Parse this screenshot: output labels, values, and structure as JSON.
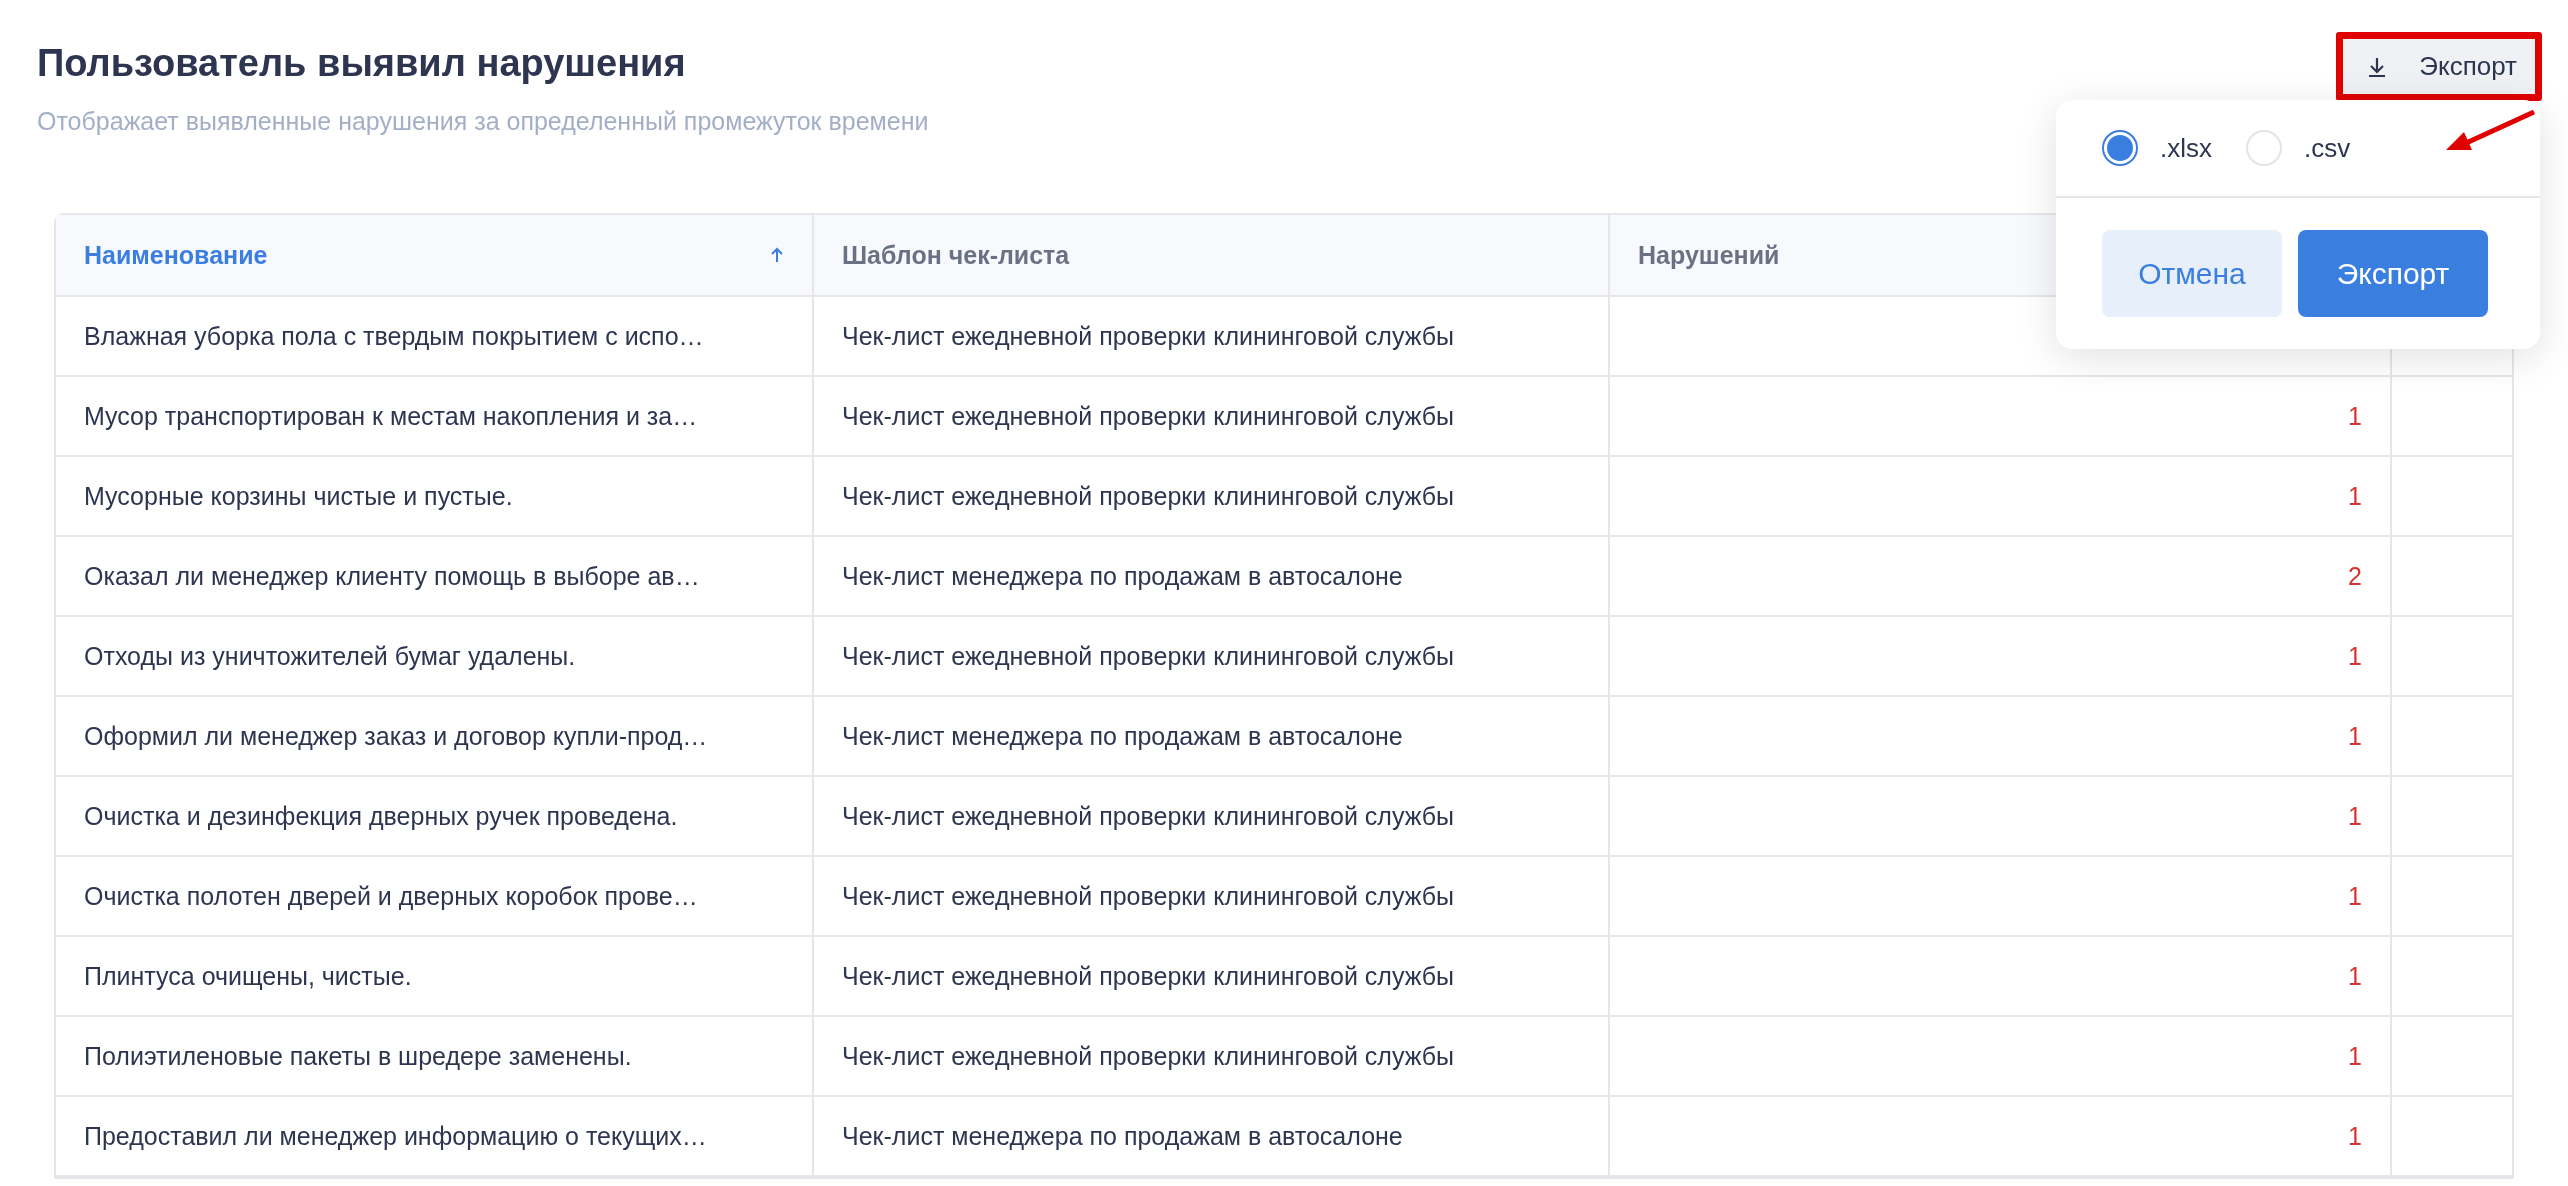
{
  "header": {
    "title": "Пользователь выявил нарушения",
    "subtitle": "Отображает выявленные нарушения за определенный промежуток времени",
    "export_button": "Экспорт"
  },
  "export_popup": {
    "formats": [
      {
        "label": ".xlsx",
        "selected": true
      },
      {
        "label": ".csv",
        "selected": false
      }
    ],
    "cancel": "Отмена",
    "confirm": "Экспорт"
  },
  "table": {
    "columns": [
      {
        "label": "Наименование",
        "sorted": true
      },
      {
        "label": "Шаблон чек-листа",
        "sorted": false
      },
      {
        "label": "Нарушений",
        "sorted": false
      }
    ],
    "rows": [
      {
        "name": "Влажная уборка пола с твердым покрытием с испо…",
        "template": "Чек-лист ежедневной проверки клининговой службы"
      },
      {
        "name": "Мусор транспортирован к местам накопления и за…",
        "template": "Чек-лист ежедневной проверки клининговой службы",
        "violations": "1"
      },
      {
        "name": "Мусорные корзины чистые и пустые.",
        "template": "Чек-лист ежедневной проверки клининговой службы",
        "violations": "1"
      },
      {
        "name": "Оказал ли менеджер клиенту помощь в выборе ав…",
        "template": "Чек-лист менеджера по продажам в автосалоне",
        "violations": "2"
      },
      {
        "name": "Отходы из уничтожителей бумаг удалены.",
        "template": "Чек-лист ежедневной проверки клининговой службы",
        "violations": "1"
      },
      {
        "name": "Оформил ли менеджер заказ и договор купли-прод…",
        "template": "Чек-лист менеджера по продажам в автосалоне",
        "violations": "1"
      },
      {
        "name": "Очистка и дезинфекция дверных ручек проведена.",
        "template": "Чек-лист ежедневной проверки клининговой службы",
        "violations": "1"
      },
      {
        "name": "Очистка полотен дверей и дверных коробок прове…",
        "template": "Чек-лист ежедневной проверки клининговой службы",
        "violations": "1"
      },
      {
        "name": "Плинтуса очищены, чистые.",
        "template": "Чек-лист ежедневной проверки клининговой службы",
        "violations": "1"
      },
      {
        "name": "Полиэтиленовые пакеты в шредере заменены.",
        "template": "Чек-лист ежедневной проверки клининговой службы",
        "violations": "1"
      },
      {
        "name": "Предоставил ли менеджер информацию о текущих…",
        "template": "Чек-лист менеджера по продажам в автосалоне",
        "violations": "1"
      }
    ]
  }
}
